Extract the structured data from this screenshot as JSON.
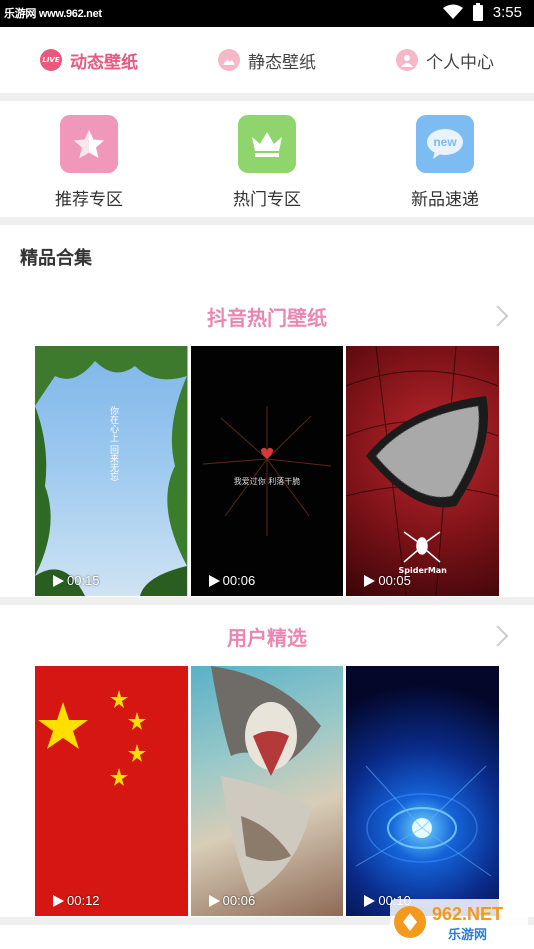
{
  "status_bar": {
    "watermark": "乐游网 www.962.net",
    "time": "3:55"
  },
  "top_nav": {
    "tabs": [
      {
        "label": "动态壁纸",
        "icon": "live-icon",
        "active": true,
        "badge": "LIVE"
      },
      {
        "label": "静态壁纸",
        "icon": "image-icon",
        "active": false
      },
      {
        "label": "个人中心",
        "icon": "person-icon",
        "active": false
      }
    ]
  },
  "quick_links": [
    {
      "label": "推荐专区",
      "icon": "star-icon",
      "color": "#f197b9"
    },
    {
      "label": "热门专区",
      "icon": "crown-icon",
      "color": "#8fd46d"
    },
    {
      "label": "新品速递",
      "icon": "new-icon",
      "color": "#7cbcf2",
      "icon_text": "new"
    }
  ],
  "section": {
    "title": "精品合集"
  },
  "collections": [
    {
      "title": "抖音热门壁纸",
      "items": [
        {
          "duration": "00:15",
          "caption": "你在心上 回来无忘"
        },
        {
          "duration": "00:06",
          "caption": "我爱过你 利落干脆"
        },
        {
          "duration": "00:05",
          "caption": "SpiderMan"
        }
      ]
    },
    {
      "title": "用户精选",
      "items": [
        {
          "duration": "00:12"
        },
        {
          "duration": "00:06"
        },
        {
          "duration": "00:10"
        }
      ]
    }
  ],
  "bottom_watermark": {
    "text_top": "962.NET",
    "text_bottom": "乐游网"
  },
  "accent_color": "#e8587f"
}
